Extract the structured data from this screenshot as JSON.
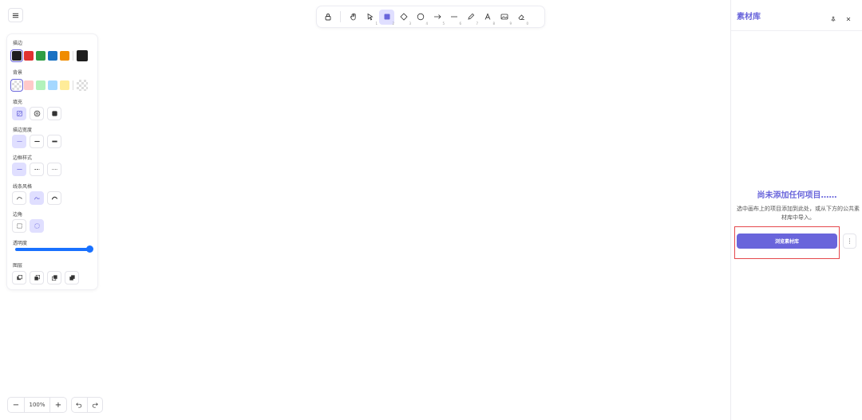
{
  "corner_mark": "’",
  "toolbar": {
    "tools": [
      {
        "name": "lock",
        "num": ""
      },
      {
        "name": "hand",
        "num": ""
      },
      {
        "name": "select",
        "num": "1"
      },
      {
        "name": "rectangle",
        "num": "2"
      },
      {
        "name": "diamond",
        "num": "3"
      },
      {
        "name": "ellipse",
        "num": "4"
      },
      {
        "name": "arrow",
        "num": "5"
      },
      {
        "name": "line",
        "num": "6"
      },
      {
        "name": "pencil",
        "num": "7"
      },
      {
        "name": "text",
        "num": "8"
      },
      {
        "name": "image",
        "num": "9"
      },
      {
        "name": "eraser",
        "num": "0"
      }
    ],
    "active_tool": "rectangle"
  },
  "props": {
    "stroke_label": "描边",
    "background_label": "背景",
    "fill_label": "填充",
    "stroke_width_label": "描边宽度",
    "stroke_style_label": "边框样式",
    "sloppiness_label": "线条风格",
    "edges_label": "边角",
    "opacity_label": "透明度",
    "layers_label": "图层",
    "stroke_colors": [
      "#1e1e1e",
      "#e03131",
      "#2f9e44",
      "#1971c2",
      "#f08c00"
    ],
    "stroke_current": "#1e1e1e",
    "bg_colors": [
      "transparent",
      "#ffc9c9",
      "#b2f2bb",
      "#a5d8ff",
      "#ffec99"
    ],
    "opacity": 100
  },
  "zoom": {
    "value": "100%",
    "minus": "−",
    "plus": "+"
  },
  "library": {
    "title": "素材库",
    "empty_title": "尚未添加任何项目……",
    "empty_desc": "选中画布上的项目添加到此处，或从下方的公共素材库中导入。",
    "browse_label": "浏览素材库",
    "more": "⋮"
  },
  "colors": {
    "accent": "#6965db",
    "accent_light": "#e0dfff",
    "slider": "#1971ff",
    "highlight": "#e5484d"
  }
}
